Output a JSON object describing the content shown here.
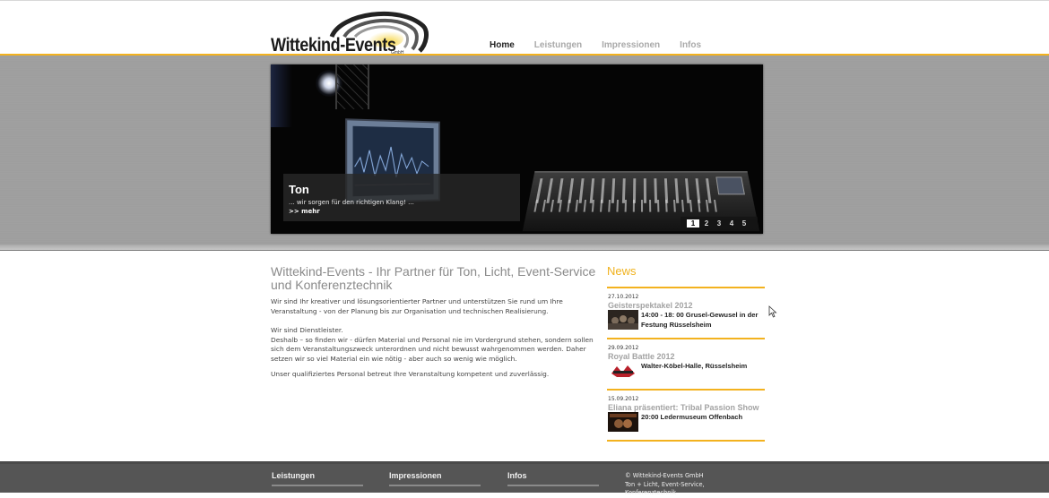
{
  "header": {
    "logo_text": "Wittekind-Events",
    "logo_suffix": "GmbH",
    "nav": [
      {
        "label": "Home",
        "active": true
      },
      {
        "label": "Leistungen",
        "active": false
      },
      {
        "label": "Impressionen",
        "active": false
      },
      {
        "label": "Infos",
        "active": false
      }
    ]
  },
  "slider": {
    "title": "Ton",
    "subtitle": "... wir sorgen für den richtigen Klang! ...",
    "more_link": ">> mehr",
    "pages": [
      "1",
      "2",
      "3",
      "4",
      "5"
    ],
    "current_page": "1"
  },
  "main": {
    "heading": "Wittekind-Events - Ihr Partner für Ton, Licht, Event-Service und Konferenztechnik",
    "paragraph1": "Wir sind Ihr kreativer und lösungsorientierter Partner und unterstützen Sie rund um Ihre Veranstaltung - von der Planung bis zur Organisation und technischen Realisierung.",
    "paragraph2_line1": "Wir sind Dienstleister.",
    "paragraph2_line2": "Deshalb – so finden wir - dürfen Material und Personal nie im Vordergrund stehen, sondern sollen sich dem Veranstaltungszweck unterordnen und nicht bewusst wahrgenommen werden. Daher setzen wir so viel Material ein wie nötig - aber auch so wenig wie möglich.",
    "paragraph3": "Unser qualifiziertes Personal betreut Ihre Veranstaltung kompetent und zuverlässig."
  },
  "news": {
    "heading": "News",
    "items": [
      {
        "date": "27.10.2012",
        "title": "Geisterspektakel 2012",
        "text": "14:00 - 18: 00 Grusel-Gewusel in der Festung Rüsselsheim"
      },
      {
        "date": "29.09.2012",
        "title": "Royal Battle 2012",
        "text": "Walter-Köbel-Halle, Rüsselsheim"
      },
      {
        "date": "15.09.2012",
        "title": "Eliana präsentiert: Tribal Passion Show",
        "text": "20:00 Ledermuseum Offenbach"
      }
    ]
  },
  "footer": {
    "columns": [
      "Leistungen",
      "Impressionen",
      "Infos"
    ],
    "contact_line1": "© Wittekind-Events GmbH",
    "contact_line2": "Ton + Licht, Event-Service,",
    "contact_line3": "Konferenztechnik"
  },
  "colors": {
    "accent": "#f3b21f",
    "footer_bg": "#555555",
    "band_bg": "#9e9e9e"
  }
}
